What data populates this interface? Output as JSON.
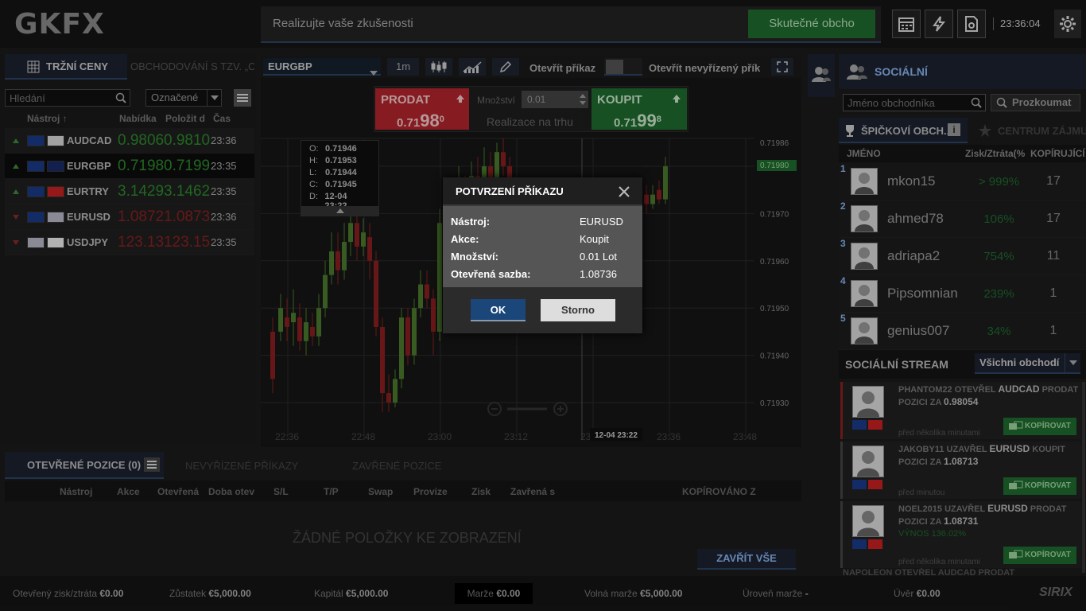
{
  "logo": "GKFX",
  "header": {
    "tagline": "Realizujte vaše zkušenosti",
    "real_button": "Skutečné obcho",
    "clock": "23:36:04",
    "icons": [
      "calendar-icon",
      "lightning-icon",
      "document-icon",
      "gear-icon"
    ]
  },
  "market": {
    "tab_prices": "TRŽNÍ CENY",
    "tab_trading": "OBCHODOVÁNÍ S TZV. „C",
    "search_placeholder": "Hledání",
    "filter": "Označené",
    "columns": [
      "Nástroj ↑",
      "Nabídka",
      "Položit d",
      "Čas"
    ],
    "rows": [
      {
        "symbol": "AUDCAD",
        "bid": "0.9806",
        "ask": "0.9810",
        "time": "23:36",
        "dir": "up",
        "color": "green"
      },
      {
        "symbol": "EURGBP",
        "bid": "0.7198",
        "ask": "0.7199",
        "time": "23:35",
        "dir": "up",
        "color": "green"
      },
      {
        "symbol": "EURTRY",
        "bid": "3.1429",
        "ask": "3.1462",
        "time": "23:35",
        "dir": "up",
        "color": "green"
      },
      {
        "symbol": "EURUSD",
        "bid": "1.0872",
        "ask": "1.0873",
        "time": "23:36",
        "dir": "down",
        "color": "red"
      },
      {
        "symbol": "USDJPY",
        "bid": "123.13",
        "ask": "123.15",
        "time": "23:35",
        "dir": "down",
        "color": "red"
      }
    ]
  },
  "chart": {
    "symbol": "EURGBP",
    "timeframe": "1m",
    "open_order": "Otevřít příkaz",
    "open_pending": "Otevřít nevyřízený přík",
    "sell_label": "PRODAT",
    "sell_price_main": "0.71",
    "sell_price_big": "98",
    "sell_price_sup": "0",
    "buy_label": "KOUPIT",
    "buy_price_main": "0.71",
    "buy_price_big": "99",
    "buy_price_sup": "8",
    "qty_label": "Množství",
    "qty_value": "0.01",
    "exec_label": "Realizace na trhu",
    "ohlc": {
      "o": "0.71946",
      "h": "0.71953",
      "l": "0.71944",
      "c": "0.71945",
      "d": "12-04 23:22"
    },
    "ohlc_labels": {
      "o": "O:",
      "h": "H:",
      "l": "L:",
      "c": "C:",
      "d": "D:"
    },
    "y_ticks": [
      "0.71980",
      "0.71970",
      "0.71960",
      "0.71950",
      "0.71940",
      "0.71930"
    ],
    "y_top": "0.71986",
    "current_price": "0.71980",
    "x_ticks": [
      "22:36",
      "22:48",
      "23:00",
      "23:12",
      "23:24",
      "23:36",
      "23:48"
    ],
    "cursor_label": "12-04 23:22"
  },
  "modal": {
    "title": "POTVRZENÍ PŘÍKAZU",
    "rows": [
      {
        "k": "Nástroj:",
        "v": "EURUSD"
      },
      {
        "k": "Akce:",
        "v": "Koupit"
      },
      {
        "k": "Množství:",
        "v": "0.01 Lot"
      },
      {
        "k": "Otevřená sazba:",
        "v": "1.08736"
      }
    ],
    "ok": "OK",
    "cancel": "Storno"
  },
  "positions": {
    "tab_open": "OTEVŘENÉ POZICE (0)",
    "tab_pending": "NEVYŘÍZENÉ PŘÍKAZY",
    "tab_closed": "ZAVŘENÉ POZICE",
    "columns": [
      "Nástroj",
      "Akce",
      "Otevřená",
      "Doba otev",
      "S/L",
      "T/P",
      "Swap",
      "Provize",
      "Zisk",
      "Zavřená s"
    ],
    "copied_from": "KOPÍROVÁNO Z",
    "empty": "ŽÁDNÉ POLOŽKY KE ZOBRAZENÍ",
    "close_all": "ZAVŘÍT VŠE"
  },
  "social": {
    "title": "SOCIÁLNÍ",
    "search_placeholder": "Jméno obchodníka",
    "explore": "Prozkoumat",
    "tab_top": "ŠPIČKOVÍ OBCH...",
    "tab_interest": "CENTRUM ZÁJMU",
    "columns": [
      "JMÉNO",
      "Zisk/Ztráta(%",
      "KOPÍRUJÍCÍ"
    ],
    "traders": [
      {
        "rank": "1",
        "name": "mkon15",
        "pl": "> 999%",
        "copiers": "17"
      },
      {
        "rank": "2",
        "name": "ahmed78",
        "pl": "106%",
        "copiers": "17"
      },
      {
        "rank": "3",
        "name": "adriapa2",
        "pl": "754%",
        "copiers": "11"
      },
      {
        "rank": "4",
        "name": "Pipsomnian",
        "pl": "239%",
        "copiers": "1"
      },
      {
        "rank": "5",
        "name": "genius007",
        "pl": "34%",
        "copiers": "1"
      }
    ],
    "stream_title": "SOCIÁLNÍ STREAM",
    "stream_filter": "Všichni obchodí",
    "stream": [
      {
        "line1": "PHANTOM22 OTEVŘEL ",
        "sym": "AUDCAD",
        "line1b": " PRODAT",
        "line2": "POZICI ZA ",
        "price": "0.98054",
        "extra": "",
        "time": "před několika minutami",
        "copy": "KOPÍROVAT"
      },
      {
        "line1": "JAKOBY11 UZAVŘEL ",
        "sym": "EURUSD",
        "line1b": " KOUPIT",
        "line2": "POZICI ZA ",
        "price": "1.08713",
        "extra": "",
        "time": "před minutou",
        "copy": "KOPÍROVAT"
      },
      {
        "line1": "NOEL2015 UZAVŘEL ",
        "sym": "EURUSD",
        "line1b": " PRODAT",
        "line2": "POZICI ZA ",
        "price": "1.08731",
        "extra": "VÝNOS 136.02%",
        "time": "před několika minutami",
        "copy": "KOPÍROVAT"
      }
    ],
    "stream_partial": "NAPOLEON OTEVŘEL AUDCAD PRODAT"
  },
  "footer": {
    "pl_label": "Otevřený zisk/ztráta",
    "pl": "€0.00",
    "balance_label": "Zůstatek",
    "balance": "€5,000.00",
    "capital_label": "Kapitál",
    "capital": "€5,000.00",
    "margin_label": "Marže",
    "margin": "€0.00",
    "free_label": "Volná marže",
    "free": "€5,000.00",
    "level_label": "Úroveň marže",
    "level": "-",
    "credit_label": "Úvěr",
    "credit": "€0.00",
    "brand": "SIRIX"
  },
  "colors": {
    "green": "#1e6b2f",
    "red": "#b3242d",
    "blue": "#1b467a"
  }
}
